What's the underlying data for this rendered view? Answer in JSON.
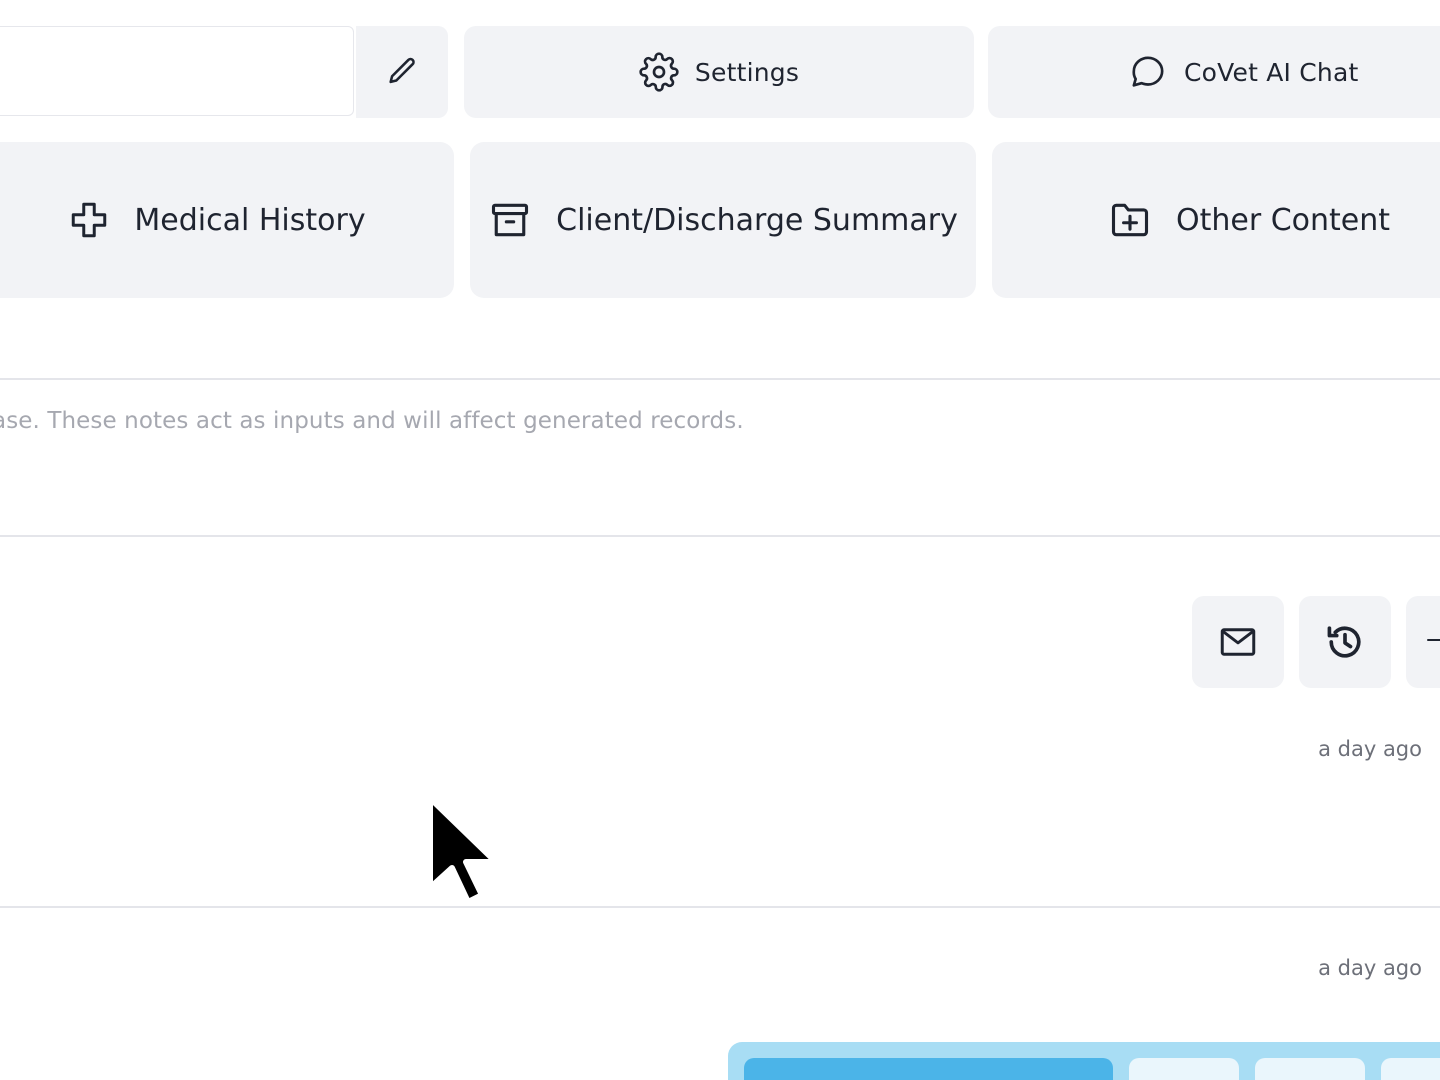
{
  "header": {
    "name_input_value": "",
    "edit_icon": "pencil-icon",
    "settings_label": "Settings",
    "settings_icon": "gear-icon",
    "chat_label": "CoVet AI Chat",
    "chat_icon": "chat-bubble-icon"
  },
  "sections": {
    "medical_history_label": "Medical History",
    "medical_history_icon": "medical-cross-icon",
    "client_summary_label": "Client/Discharge Summary",
    "client_summary_icon": "archive-box-icon",
    "other_content_label": "Other Content",
    "other_content_icon": "folder-plus-icon"
  },
  "notes": {
    "placeholder": "ase. These notes act as inputs and will affect generated records."
  },
  "records": {
    "actions": [
      {
        "icon": "mail-icon"
      },
      {
        "icon": "history-icon"
      }
    ],
    "items": [
      {
        "timestamp": "a day ago"
      },
      {
        "timestamp": "a day ago"
      }
    ]
  },
  "colors": {
    "button_bg": "#f2f3f6",
    "divider": "#e4e5ea",
    "placeholder_text": "#a6a8b0",
    "accent_light": "#a8ddf4",
    "accent": "#4bb4e8"
  }
}
